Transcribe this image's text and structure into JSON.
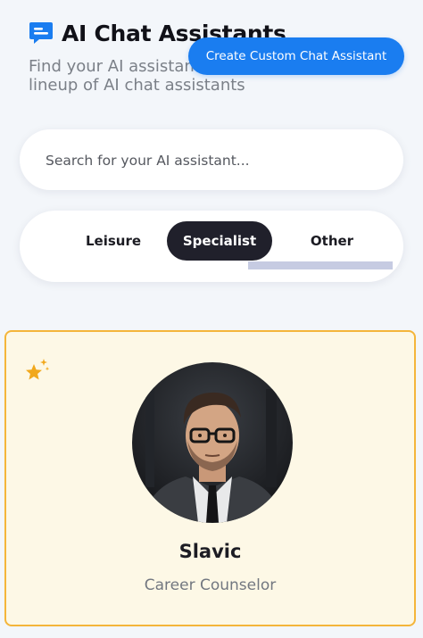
{
  "header": {
    "icon": "chat-bubble-icon",
    "title": "AI Chat Assistants",
    "subtitle": "Find your AI assistant or explore our fantastic lineup of AI chat assistants"
  },
  "create_button": {
    "label": "Create Custom Chat Assistant"
  },
  "search": {
    "placeholder": "Search for your AI assistant..."
  },
  "tabs": [
    {
      "label": "Leisure",
      "selected": false
    },
    {
      "label": "Specialist",
      "selected": true
    },
    {
      "label": "Other",
      "selected": false
    }
  ],
  "card": {
    "badge_icon": "sparkle-stars-icon",
    "name": "Slavic",
    "role": "Career Counselor"
  },
  "colors": {
    "primary": "#1a7df0",
    "tab_selected": "#20202b",
    "card_border": "#f4b53a",
    "card_background": "#fdf8e6",
    "page_background": "#f3f6fa"
  }
}
